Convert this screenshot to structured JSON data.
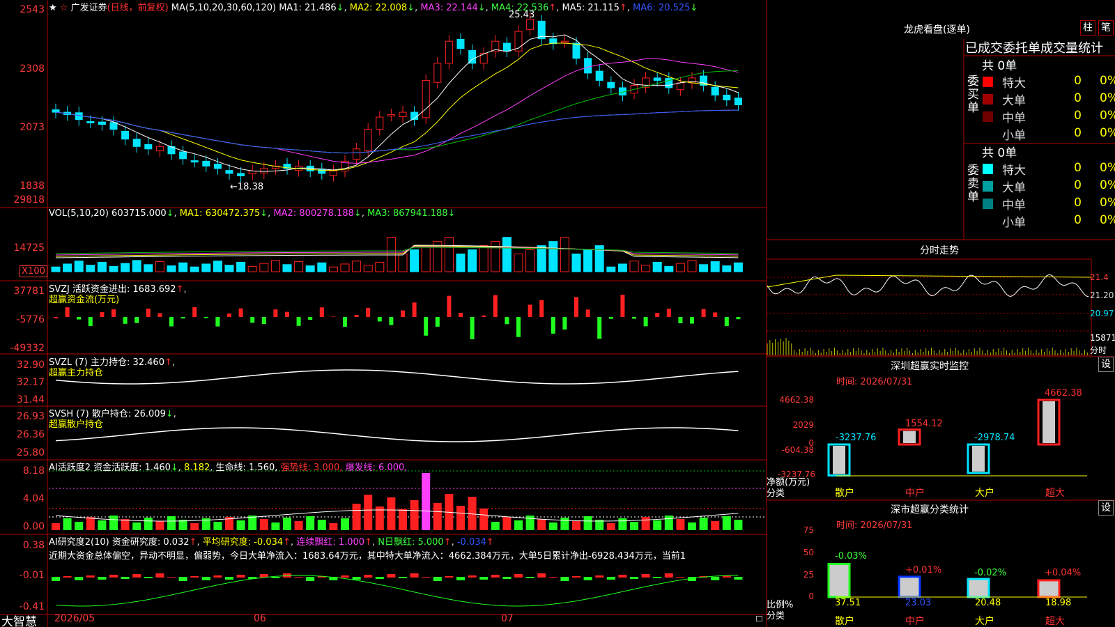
{
  "stock": {
    "name": "广发证券",
    "mode": "(日线，前复权)",
    "ma_label": "MA(5,10,20,30,60,120)",
    "ma1": "MA1: 21.486",
    "ma2": "MA2: 22.008",
    "ma3": "MA3: 22.144",
    "ma4": "MA4: 22.536",
    "ma5": "MA5: 21.115",
    "ma6": "MA6: 20.525",
    "arrow_up": "↑",
    "arrow_dn": "↓",
    "star": "★",
    "pin": "☆",
    "high_mark": "25.43",
    "low_mark": "←18.38"
  },
  "axes": {
    "price": [
      "2543",
      "2308",
      "2073",
      "1838"
    ],
    "vol": [
      "29818",
      "14725"
    ],
    "vol_unit": "X100",
    "svzj": [
      "37781",
      "-5776",
      "-49332"
    ],
    "svzl": [
      "32.90",
      "32.17",
      "31.44"
    ],
    "svsh": [
      "26.93",
      "26.36",
      "25.80"
    ],
    "ai1": [
      "8.18",
      "4.04",
      "0.00"
    ],
    "ai2": [
      "0.38",
      "-0.01",
      "-0.41"
    ],
    "dates": [
      "2026/05",
      "06",
      "07"
    ]
  },
  "panels": {
    "vol": {
      "title": "VOL(5,10,20)",
      "val": "603715.000",
      "ma1": "MA1: 630472.375",
      "ma2": "MA2: 800278.188",
      "ma3": "MA3: 867941.188"
    },
    "svzj": {
      "title": "SVZJ  活跃资金进出: 1683.692",
      "sub": "超赢资金流(万元)"
    },
    "svzl": {
      "title": "SVZL (7) 主力持仓: 32.460",
      "sub": "超赢主力持仓"
    },
    "svsh": {
      "title": "SVSH (7) 散户持仓: 26.009",
      "sub": "超赢散户持仓"
    },
    "ai1": {
      "title": "AI活跃度2 资金活跃度: 1.460",
      "v2": "8.182",
      "life": "生命线: 1.560,",
      "strong": "强势线: 3.000,",
      "burst": "爆发线: 6.000,"
    },
    "ai2": {
      "title": "AI研究度2(10) 资金研究度: 0.032",
      "avg": "平均研究度: -0.034",
      "red": "连续飘红: 1.000",
      "nred": "N日飘红: 5.000",
      "last": "-0.034",
      "text": "近期大资金总体偏空，异动不明显，偏弱势，今日大单净流入：1683.64万元，其中特大单净流入：4662.384万元，大单5日累计净出-6928.434万元，当前1"
    }
  },
  "footer": {
    "brand": "大智慧"
  },
  "lhb": {
    "title": "龙虎看盘(逐单)",
    "btn1": "柱",
    "btn2": "笔",
    "header": "已成交委托单成交量统计",
    "buy": {
      "side": "委买单",
      "total": "共 0单",
      "rows": [
        {
          "name": "特大",
          "v": "0",
          "p": "0%",
          "color": "#ff0000"
        },
        {
          "name": "大单",
          "v": "0",
          "p": "0%",
          "color": "#a00000"
        },
        {
          "name": "中单",
          "v": "0",
          "p": "0%",
          "color": "#700000"
        },
        {
          "name": "小单",
          "v": "0",
          "p": "0%",
          "color": "#000000"
        }
      ]
    },
    "sell": {
      "side": "委卖单",
      "total": "共 0单",
      "rows": [
        {
          "name": "特大",
          "v": "0",
          "p": "0%",
          "color": "#00ffff"
        },
        {
          "name": "大单",
          "v": "0",
          "p": "0%",
          "color": "#00a0a0"
        },
        {
          "name": "中单",
          "v": "0",
          "p": "0%",
          "color": "#008080"
        },
        {
          "name": "小单",
          "v": "0",
          "p": "0%",
          "color": "#000000"
        }
      ]
    }
  },
  "intraday": {
    "title": "分时走势",
    "p1": "21.4",
    "p2": "21.20",
    "p3": "20.97",
    "vol": "15871",
    "unit": "分时"
  },
  "monitor": {
    "title": "深圳超赢实时监控",
    "btn": "设",
    "time": "时间: 2026/07/31",
    "axis": [
      "4662.38",
      "2029",
      "0",
      "-604.38",
      "-3237.76"
    ],
    "ylabel": "净额(万元)",
    "xlabel": "分类",
    "cats": [
      "散户",
      "中户",
      "大户",
      "超大"
    ],
    "labels": [
      "-3237.76",
      "1554.12",
      "-2978.74",
      "4662.38"
    ]
  },
  "stats": {
    "title": "深市超赢分类统计",
    "btn": "设",
    "time": "时间: 2026/07/31",
    "axis": [
      "75",
      "50",
      "25",
      "0"
    ],
    "ylabel": "比例%",
    "xlabel": "分类",
    "cats": [
      "散户",
      "中户",
      "大户",
      "超大"
    ],
    "top": [
      "-0.03%",
      "+0.01%",
      "-0.02%",
      "+0.04%"
    ],
    "bottom": [
      "37.51",
      "23.03",
      "20.48",
      "18.98"
    ]
  },
  "chart_data": [
    {
      "type": "bar",
      "title": "深圳超赢实时监控",
      "ylabel": "净额(万元)",
      "xlabel": "分类",
      "categories": [
        "散户",
        "中户",
        "大户",
        "超大"
      ],
      "values": [
        -3237.76,
        1554.12,
        -2978.74,
        4662.38
      ],
      "ylim": [
        -3237.76,
        4662.38
      ]
    },
    {
      "type": "bar",
      "title": "深市超赢分类统计",
      "ylabel": "比例%",
      "xlabel": "分类",
      "categories": [
        "散户",
        "中户",
        "大户",
        "超大"
      ],
      "values": [
        37.51,
        23.03,
        20.48,
        18.98
      ],
      "ylim": [
        0,
        75
      ]
    }
  ],
  "colors": {
    "up": "#ff2020",
    "down": "#00e5ff",
    "grid": "#b00000",
    "bg": "#000000"
  }
}
